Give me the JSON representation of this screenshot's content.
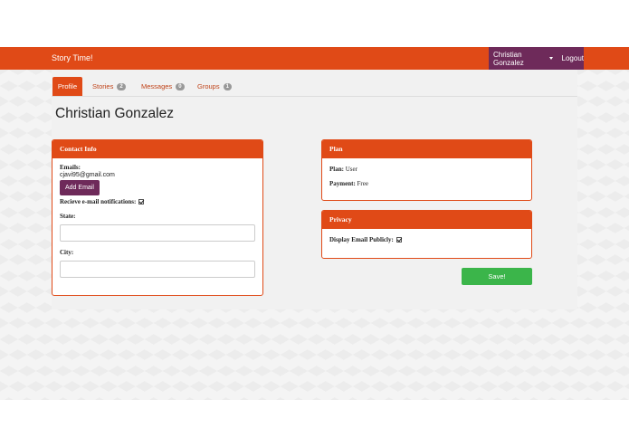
{
  "navbar": {
    "brand": "Story Time!",
    "user": "Christian Gonzalez",
    "logout": "Logout"
  },
  "tabs": [
    {
      "label": "Profile",
      "badge": null
    },
    {
      "label": "Stories",
      "badge": "2"
    },
    {
      "label": "Messages",
      "badge": "0"
    },
    {
      "label": "Groups",
      "badge": "1"
    }
  ],
  "page": {
    "title": "Christian Gonzalez"
  },
  "contact": {
    "heading": "Contact Info",
    "emails_label": "Emails:",
    "email": "cjavi95@gmail.com",
    "add_email": "Add Email",
    "notify_label": "Recieve e-mail notifications:",
    "notify_checked": true,
    "state_label": "State:",
    "state_value": "",
    "city_label": "City:",
    "city_value": ""
  },
  "plan": {
    "heading": "Plan",
    "plan_label": "Plan:",
    "plan_value": "User",
    "payment_label": "Payment:",
    "payment_value": "Free"
  },
  "privacy": {
    "heading": "Privacy",
    "display_label": "Display Email Publicly:",
    "display_checked": true
  },
  "actions": {
    "save": "Save!"
  },
  "colors": {
    "accent": "#e04a17",
    "user_menu": "#6e2a5a",
    "save": "#3bb54a"
  }
}
